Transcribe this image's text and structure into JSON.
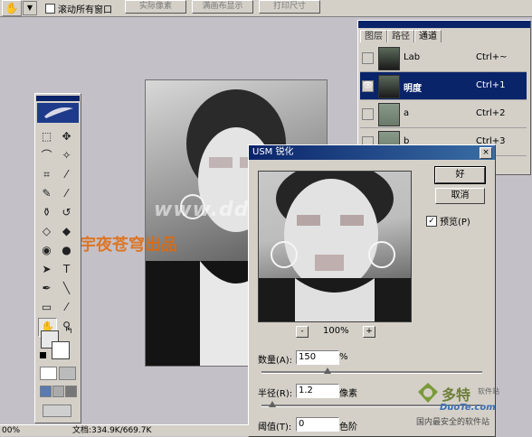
{
  "options_bar": {
    "scroll_all_label": "滚动所有窗口",
    "buttons": [
      "实际像素",
      "满画布显示",
      "打印尺寸"
    ]
  },
  "channels_panel": {
    "tabs": [
      "图层",
      "路径",
      "通道"
    ],
    "active_tab": "通道",
    "channels": [
      {
        "name": "Lab",
        "shortcut": "Ctrl+~",
        "selected": false
      },
      {
        "name": "明度",
        "shortcut": "Ctrl+1",
        "selected": true
      },
      {
        "name": "a",
        "shortcut": "Ctrl+2",
        "selected": false
      },
      {
        "name": "b",
        "shortcut": "Ctrl+3",
        "selected": false
      }
    ]
  },
  "usm_dialog": {
    "title": "USM 锐化",
    "ok_label": "好",
    "cancel_label": "取消",
    "preview_label": "预览(P)",
    "preview_checked": true,
    "zoom_minus": "-",
    "zoom_plus": "+",
    "zoom_level": "100%",
    "amount_label": "数量(A):",
    "amount_value": "150",
    "amount_unit": "%",
    "amount_fraction": 0.3,
    "radius_label": "半径(R):",
    "radius_value": "1.2",
    "radius_unit": "像素",
    "radius_fraction": 0.05,
    "threshold_label": "阈值(T):",
    "threshold_value": "0",
    "threshold_unit": "色阶",
    "close_icon": "×"
  },
  "watermarks": {
    "site_text": "www.ddooo.com",
    "publisher_text": "宇夜苍穹出品",
    "logo_cn": "多特",
    "logo_sub": "软件站",
    "logo_en": "DuoTe.com",
    "logo_tag": "国内最安全的软件站"
  },
  "status_bar": {
    "zoom": "00%",
    "doc_info": "文档:334.9K/669.7K"
  },
  "colors": {
    "titlebar": "#0a246a",
    "face": "#d4d0c8",
    "workspace": "#c4c0c8"
  }
}
